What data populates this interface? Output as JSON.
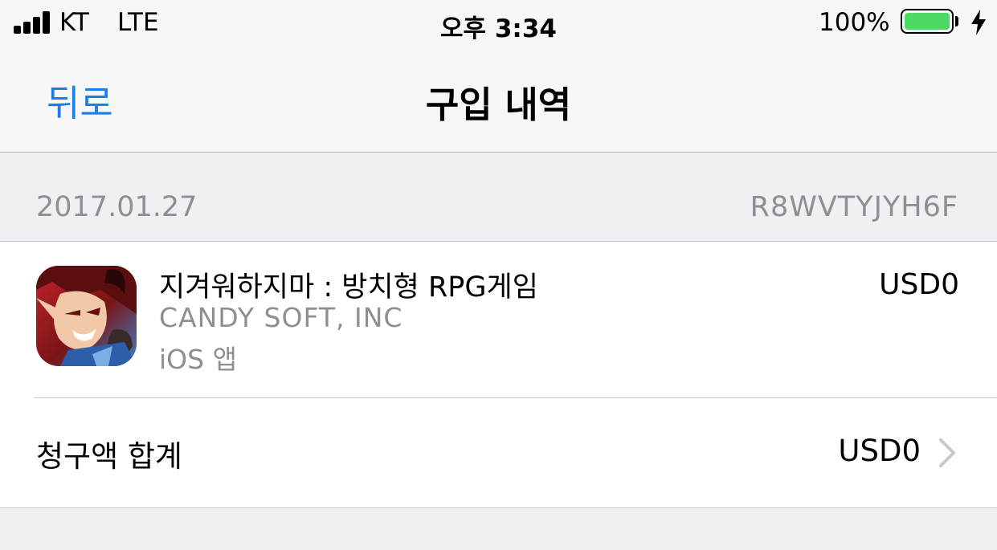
{
  "status_bar": {
    "carrier": "KT",
    "network": "LTE",
    "time": "오후 3:34",
    "battery_percent": "100%",
    "battery_level": 1.0,
    "battery_color": "#4cd964",
    "signal_icon": "signal-bars-icon",
    "charging_icon": "bolt-icon"
  },
  "nav": {
    "back_label": "뒤로",
    "title": "구입 내역",
    "accent_color": "#1a7ee6"
  },
  "purchase": {
    "date": "2017.01.27",
    "order_id": "R8WVTYJYH6F",
    "item": {
      "name": "지겨워하지마 : 방치형 RPG게임",
      "developer": "CANDY SOFT, INC",
      "type": "iOS 앱",
      "price": "USD0",
      "icon": "game-app-icon"
    },
    "total": {
      "label": "청구액 합계",
      "value": "USD0",
      "icon": "chevron-right-icon"
    }
  }
}
